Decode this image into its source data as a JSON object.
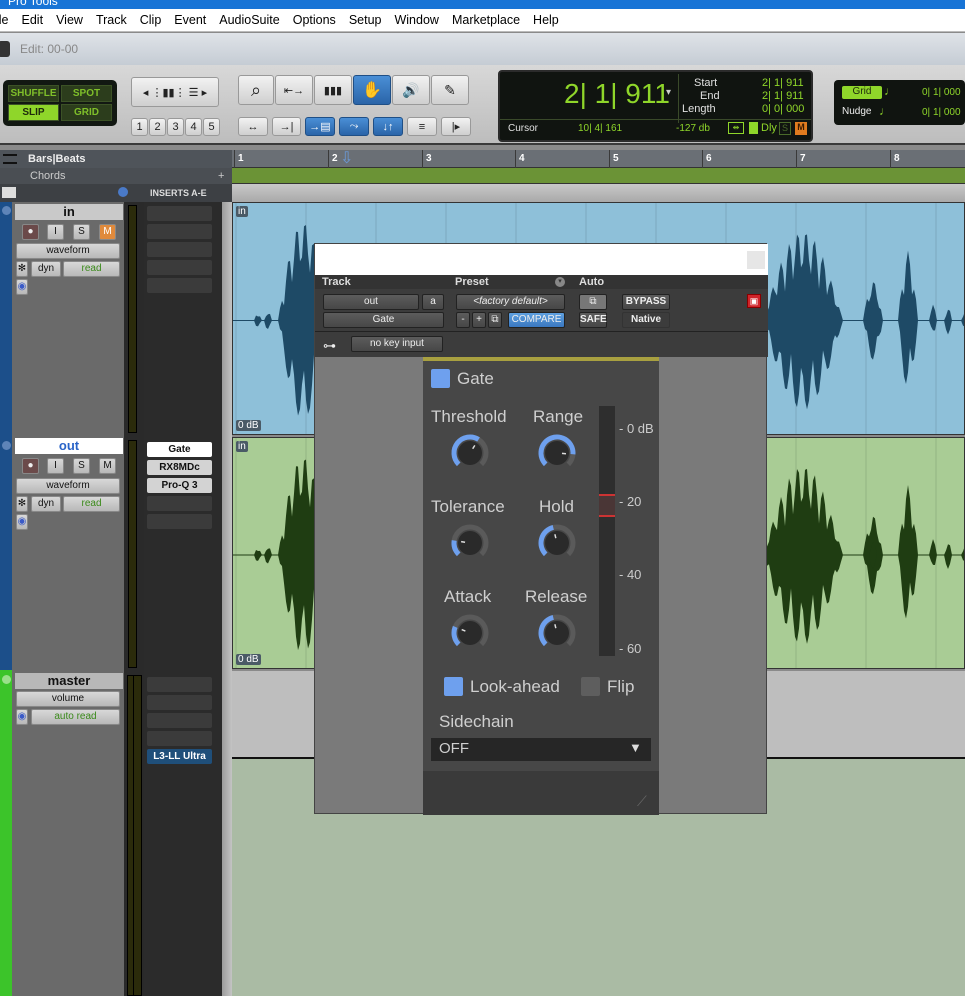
{
  "window": {
    "title": "Pro Tools"
  },
  "menu": [
    "ile",
    "Edit",
    "View",
    "Track",
    "Clip",
    "Event",
    "AudioSuite",
    "Options",
    "Setup",
    "Window",
    "Marketplace",
    "Help"
  ],
  "editbar": {
    "title": "Edit: 00-00"
  },
  "modes": {
    "shuffle": "SHUFFLE",
    "spot": "SPOT",
    "slip": "SLIP",
    "grid": "GRID"
  },
  "zoom_presets": [
    "1",
    "2",
    "3",
    "4",
    "5"
  ],
  "counter": {
    "main": "2| 1| 911",
    "start_label": "Start",
    "start": "2| 1| 911",
    "end_label": "End",
    "end": "2| 1| 911",
    "length_label": "Length",
    "length": "0| 0| 000",
    "cursor_label": "Cursor",
    "cursor": "10| 4| 161",
    "level": "-127 db",
    "dly": "Dly",
    "s": "S",
    "m": "M"
  },
  "gridnudge": {
    "grid_label": "Grid",
    "grid_value": "0| 1| 000",
    "nudge_label": "Nudge",
    "nudge_value": "0| 1| 000"
  },
  "ruler": {
    "label": "Bars|Beats",
    "chords_label": "Chords",
    "inserts_label": "INSERTS A-E",
    "bars": [
      "1",
      "2",
      "3",
      "4",
      "5",
      "6",
      "7",
      "8"
    ]
  },
  "tracks": [
    {
      "name": "in",
      "view": "waveform",
      "dyn": "dyn",
      "automation": "read",
      "rec": "",
      "input": "I",
      "solo": "S",
      "mute": "M",
      "inserts": [
        "",
        "",
        "",
        "",
        ""
      ],
      "clip_name": "in",
      "clip_gain": "0 dB",
      "color": "#8ec0d9",
      "wave_color": "#1e4a66"
    },
    {
      "name": "out",
      "view": "waveform",
      "dyn": "dyn",
      "automation": "read",
      "rec": "",
      "input": "I",
      "solo": "S",
      "mute": "M",
      "inserts": [
        "Gate",
        "RX8MDc",
        "Pro-Q 3",
        "",
        ""
      ],
      "clip_name": "in",
      "clip_gain": "0 dB",
      "color": "#a9cc95",
      "wave_color": "#1f3d12"
    },
    {
      "name": "master",
      "view": "volume",
      "automation": "auto read",
      "inserts": [
        "",
        "",
        "",
        "",
        "L3-LL Ultra"
      ]
    }
  ],
  "plugin": {
    "track_label": "Track",
    "preset_label": "Preset",
    "auto_label": "Auto",
    "track_value": "out",
    "channel": "a",
    "plugin_name": "Gate",
    "preset_value": "<factory default>",
    "minus": "-",
    "plus": "+",
    "compare": "COMPARE",
    "bypass": "BYPASS",
    "safe": "SAFE",
    "native": "Native",
    "key_input": "no key input",
    "gate_title": "Gate",
    "gate_enabled": true,
    "knobs": [
      {
        "label": "Threshold",
        "value": 0.62
      },
      {
        "label": "Range",
        "value": 0.85
      },
      {
        "label": "Tolerance",
        "value": 0.2
      },
      {
        "label": "Hold",
        "value": 0.45
      },
      {
        "label": "Attack",
        "value": 0.25
      },
      {
        "label": "Release",
        "value": 0.45
      }
    ],
    "meter_scale": [
      "- 0 dB",
      "- 20",
      "- 40",
      "- 60"
    ],
    "lookahead_label": "Look-ahead",
    "lookahead": true,
    "flip_label": "Flip",
    "flip": false,
    "sidechain_label": "Sidechain",
    "sidechain_value": "OFF"
  }
}
